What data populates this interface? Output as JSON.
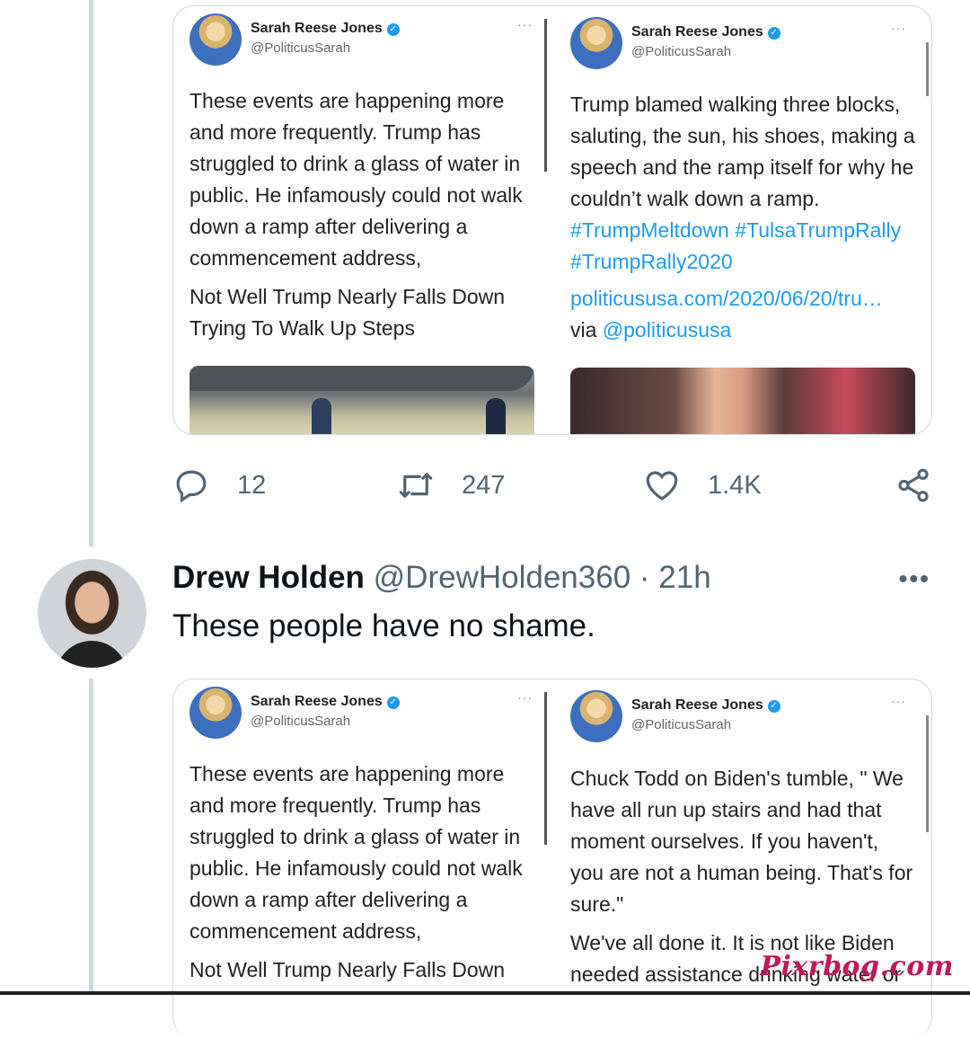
{
  "embeds": [
    {
      "left": {
        "name": "Sarah Reese Jones",
        "handle": "@PoliticusSarah",
        "more": "···",
        "paragraphs": [
          "These events are happening more and more frequently. Trump has struggled to drink a glass of water in public. He infamously could not walk down a ramp after delivering a commencement address,",
          "Not Well Trump Nearly Falls Down Trying To Walk Up Steps"
        ]
      },
      "right": {
        "name": "Sarah Reese Jones",
        "handle": "@PoliticusSarah",
        "more": "···",
        "text": "Trump blamed walking three blocks, saluting, the sun, his shoes, making a speech and the ramp itself for why he couldn’t walk down a ramp.",
        "hashtags": "#TrumpMeltdown #TulsaTrumpRally #TrumpRally2020",
        "url": "politicususa.com/2020/06/20/tru…",
        "via": "via",
        "via_handle": "@politicususa"
      }
    },
    {
      "left": {
        "name": "Sarah Reese Jones",
        "handle": "@PoliticusSarah",
        "more": "···",
        "paragraphs": [
          "These events are happening more and more frequently. Trump has struggled to drink a glass of water in public. He infamously could not walk down a ramp after delivering a commencement address,",
          "Not Well Trump Nearly Falls Down"
        ]
      },
      "right": {
        "name": "Sarah Reese Jones",
        "handle": "@PoliticusSarah",
        "more": "···",
        "paragraphs": [
          "Chuck Todd on Biden's tumble, \" We have all run up stairs and had that moment ourselves. If you haven't, you are not a human being. That's for sure.\"",
          "We've all done it. It is not like Biden needed assistance drinking water or"
        ]
      }
    }
  ],
  "actions": {
    "replies": "12",
    "retweets": "247",
    "likes": "1.4K"
  },
  "reply": {
    "name": "Drew Holden",
    "handle": "@DrewHolden360",
    "separator": "·",
    "time": "21h",
    "more": "•••",
    "text": "These people have no shame."
  },
  "watermark": "Pixrbog.com",
  "colors": {
    "link": "#1d9bf0",
    "verified": "#1d9bf0",
    "icon": "#536471"
  }
}
